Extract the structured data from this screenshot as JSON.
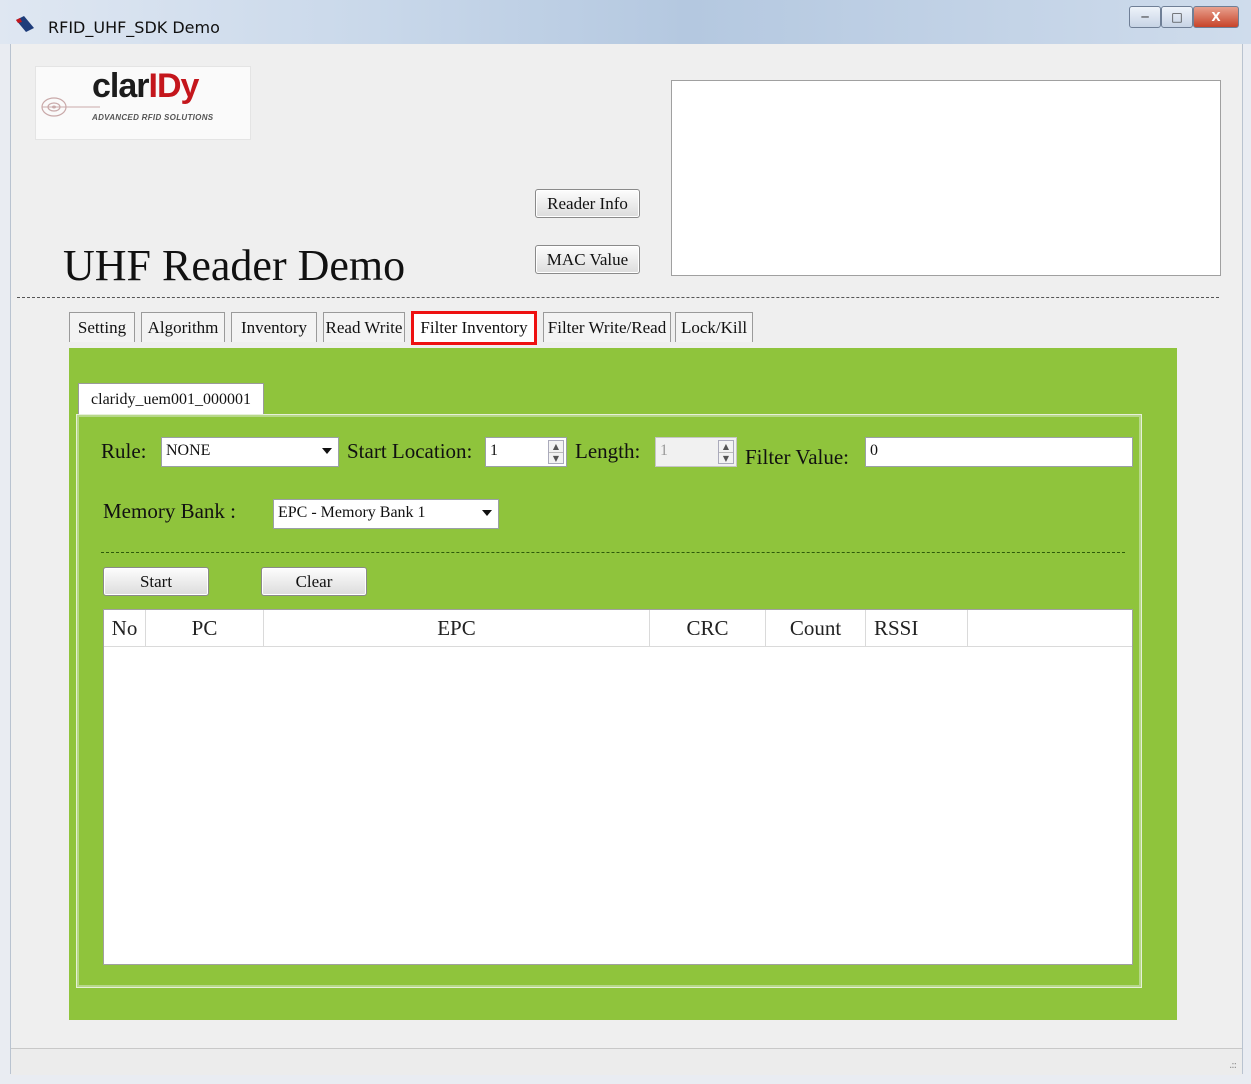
{
  "window": {
    "title": "RFID_UHF_SDK Demo",
    "min_label": "─",
    "max_label": "□",
    "close_label": "X"
  },
  "logo": {
    "main_a": "clar",
    "main_b": "IDy",
    "tagline": "ADVANCED RFID SOLUTIONS"
  },
  "header": {
    "title": "UHF Reader Demo",
    "reader_info_label": "Reader Info",
    "mac_value_label": "MAC Value",
    "info_text": ""
  },
  "tabs": [
    {
      "label": "Setting"
    },
    {
      "label": "Algorithm"
    },
    {
      "label": "Inventory"
    },
    {
      "label": "Read Write"
    },
    {
      "label": "Filter Inventory"
    },
    {
      "label": "Filter Write/Read"
    },
    {
      "label": "Lock/Kill"
    }
  ],
  "active_tab": "Filter Inventory",
  "reader_tab": {
    "label": "claridy_uem001_000001"
  },
  "filter": {
    "rule_label": "Rule:",
    "rule_value": "NONE",
    "start_location_label": "Start Location:",
    "start_location_value": "1",
    "length_label": "Length:",
    "length_value": "1",
    "filter_value_label": "Filter Value:",
    "filter_value": "0",
    "memory_bank_label": "Memory Bank :",
    "memory_bank_value": "EPC - Memory Bank 1"
  },
  "actions": {
    "start_label": "Start",
    "clear_label": "Clear"
  },
  "grid": {
    "columns": [
      "No",
      "PC",
      "EPC",
      "CRC",
      "Count",
      "RSSI"
    ],
    "rows": []
  },
  "colors": {
    "panel_green": "#8fc43c",
    "active_tab_border": "#e11111"
  }
}
